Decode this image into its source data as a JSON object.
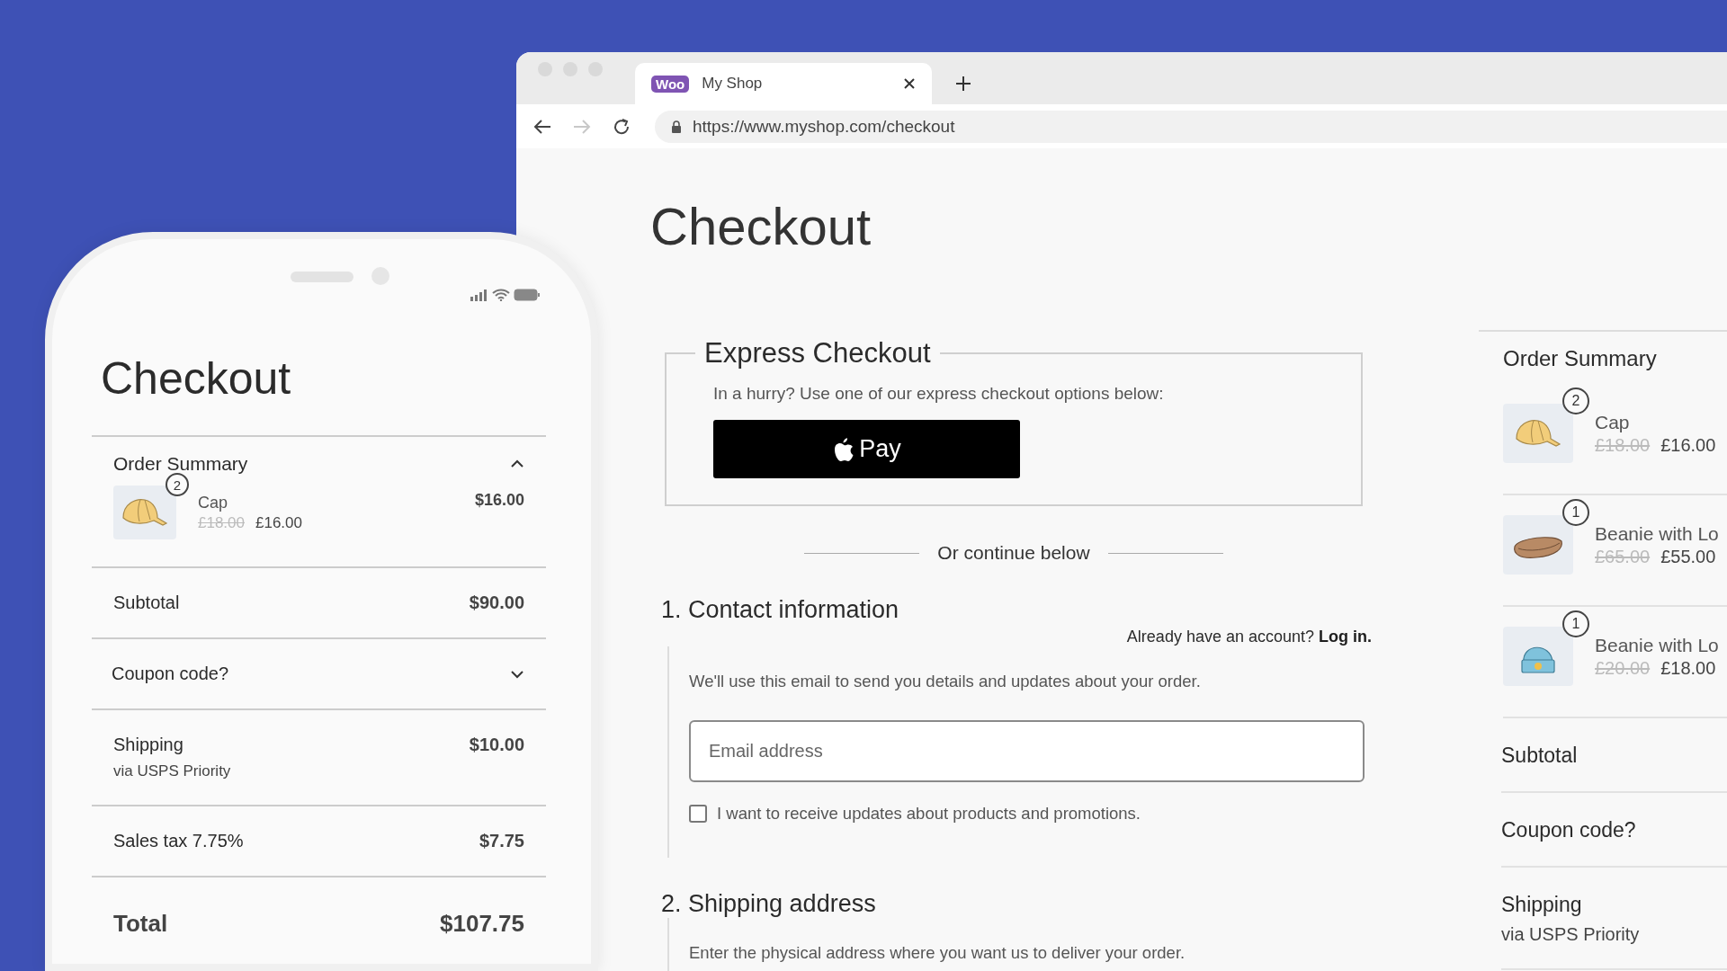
{
  "browser": {
    "tab": {
      "logo": "Woo",
      "title": "My Shop",
      "selected": true
    },
    "nav": [
      {
        "kind": "back",
        "disabled": false
      },
      {
        "kind": "forward",
        "disabled": true
      },
      {
        "kind": "reload",
        "disabled": false
      }
    ],
    "url": "https://www.myshop.com/checkout",
    "page": {
      "title": "Checkout",
      "express": {
        "legend": "Express Checkout",
        "text": "In a hurry? Use one of our express checkout options below:",
        "button": "Pay"
      },
      "divider_text": "Or continue below",
      "contact": {
        "heading": "1. Contact information",
        "account_prompt": "Already have an account?",
        "login_link": "Log in.",
        "hint": "We'll use this email to send you details and updates about your order.",
        "email_placeholder": "Email address",
        "checkbox": {
          "label": "I want to receive updates about products and promotions.",
          "checked": false
        }
      },
      "shipping": {
        "heading": "2. Shipping address",
        "hint": "Enter the physical address where you want us to deliver your order."
      },
      "summary": {
        "title": "Order Summary",
        "items": [
          {
            "kind": "cap",
            "qty": "2",
            "name": "Cap",
            "old_price": "£18.00",
            "price": "£16.00"
          },
          {
            "kind": "belt",
            "qty": "1",
            "name": "Beanie with Lo",
            "old_price": "£65.00",
            "price": "£55.00"
          },
          {
            "kind": "beanie",
            "qty": "1",
            "name": "Beanie with Lo",
            "old_price": "£20.00",
            "price": "£18.00"
          }
        ],
        "rows": [
          {
            "label": "Subtotal"
          },
          {
            "label": "Coupon code?"
          },
          {
            "label": "Shipping",
            "sub": "via USPS Priority"
          }
        ]
      }
    }
  },
  "phone": {
    "title": "Checkout",
    "summary": {
      "title": "Order Summary",
      "expanded": true,
      "items": [
        {
          "kind": "cap",
          "qty": "2",
          "name": "Cap",
          "old_price": "£18.00",
          "price": "£16.00",
          "total": "$16.00"
        }
      ]
    },
    "rows": [
      {
        "kind": "line",
        "label": "Subtotal",
        "value": "$90.00"
      },
      {
        "kind": "toggle",
        "label": "Coupon code?",
        "expanded": false
      },
      {
        "kind": "line",
        "label": "Shipping",
        "sub": "via USPS Priority",
        "value": "$10.00"
      },
      {
        "kind": "line",
        "label": "Sales tax 7.75%",
        "value": "$7.75"
      },
      {
        "kind": "total",
        "label": "Total",
        "value": "$107.75"
      }
    ]
  }
}
